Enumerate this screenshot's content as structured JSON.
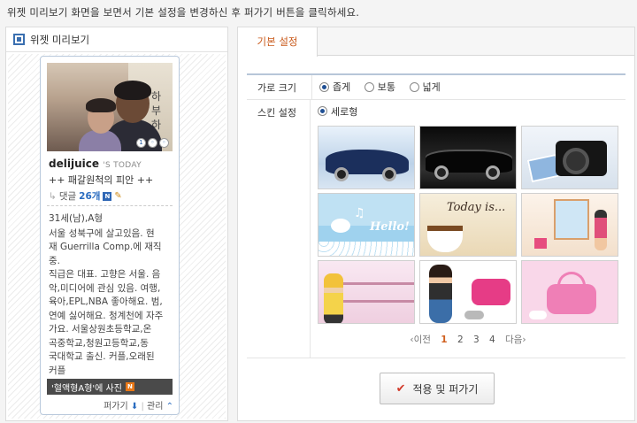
{
  "instruction": "위젯 미리보기 화면을 보면서 기본 설정을 변경하신 후 퍼가기 버튼을 클릭하세요.",
  "preview": {
    "title": "위젯 미리보기",
    "photo_overlay_text": "하 부 하",
    "username": "delijuice",
    "today_label": "'S TODAY",
    "motto": "++ 패갈원척의 피안 ++",
    "comments_label": "댓글",
    "comments_count": "26개",
    "new_badge": "N",
    "age": "31세(남),A형",
    "profile_lines": [
      "서울 성북구에 살고있음. 현",
      "재 Guerrilla Comp.에 재직중.",
      "직급은 대표. 고향은 서울. 음",
      "악,미디어에 관심 있음. 여행,",
      "육아,EPL,NBA 좋아해요. 범,",
      "연예 싫어해요. 청계천에 자주",
      "가요. 서울상원초등학교,온",
      "곡중학교,청원고등학교,동",
      "국대학교 출신. 커플,오래된",
      "커플"
    ],
    "photo_bar_text": "'혈액형A형'에 사진",
    "foot_embed": "퍼가기",
    "foot_manage": "관리"
  },
  "settings": {
    "tab_basic": "기본 설정",
    "width_label": "가로 크기",
    "width_options": [
      "좁게",
      "보통",
      "넓게"
    ],
    "skin_label": "스킨 설정",
    "skin_option": "세로형",
    "thumb_texts": {
      "hello": "Hello!",
      "today_is": "Today is..."
    },
    "pager": {
      "prev": "이전",
      "pages": [
        "1",
        "2",
        "3",
        "4"
      ],
      "next": "다음"
    },
    "apply_button": "적용 및 퍼가기"
  },
  "colors": {
    "accent": "#c95a1b",
    "link": "#2a7ac0",
    "badge_blue": "#2f67b5",
    "badge_orange": "#e87716"
  }
}
